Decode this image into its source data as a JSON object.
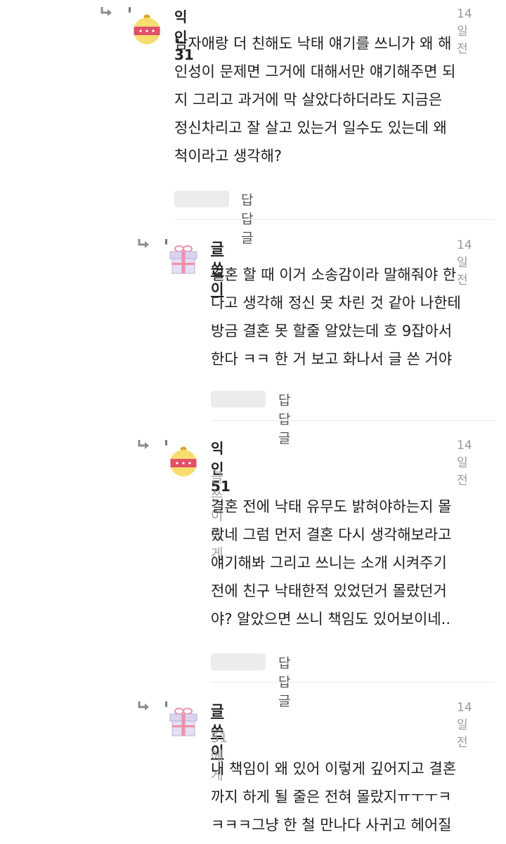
{
  "reply_button_label": "답답글",
  "comments": [
    {
      "author": "익인31",
      "time": "14일전",
      "mention": "",
      "avatar": "ornament-icon",
      "body": "남자애랑 더 친해도 낙태 얘기를 쓰니가 왜 해\n인성이 문제면 그거에 대해서만 얘기해주면 되\n지 그리고 과거에 막 살았다하더라도 지금은\n정신차리고 잘 살고 있는거 일수도 있는데 왜\n척이라고 생각해?"
    },
    {
      "author": "글쓴이",
      "time": "14일전",
      "mention": "",
      "avatar": "gift-box-icon",
      "body": "결혼 할 때 이거 소송감이라 말해줘야 한\n다고 생각해 정신 못 차린 것 같아 나한테\n방금 결혼 못 할줄 알았는데 호 9잡아서\n한다 ㅋㅋ 한 거 보고 화나서 글 쓴 거야"
    },
    {
      "author": "익인51",
      "time": "14일전",
      "mention": "글쓴이에게",
      "avatar": "ornament-icon",
      "body": "결혼 전에 낙태 유무도 밝혀야하는지 몰\n랐네 그럼 먼저 결혼 다시 생각해보라고\n얘기해봐 그리고 쓰니는 소개 시켜주기\n전에 친구 낙태한적 있었던거 몰랐던거\n야? 알았으면 쓰니 책임도 있어보이네.."
    },
    {
      "author": "글쓴이",
      "time": "14일전",
      "mention": "51에게",
      "avatar": "gift-box-icon",
      "body": "내 책임이 왜 있어 이렇게 깊어지고 결혼\n까지 하게 될 줄은 전혀 몰랐지ㅠㅜㅜㅋ\nㅋㅋㅋ그냥 한 철 만나다 사귀고 헤어질"
    }
  ]
}
